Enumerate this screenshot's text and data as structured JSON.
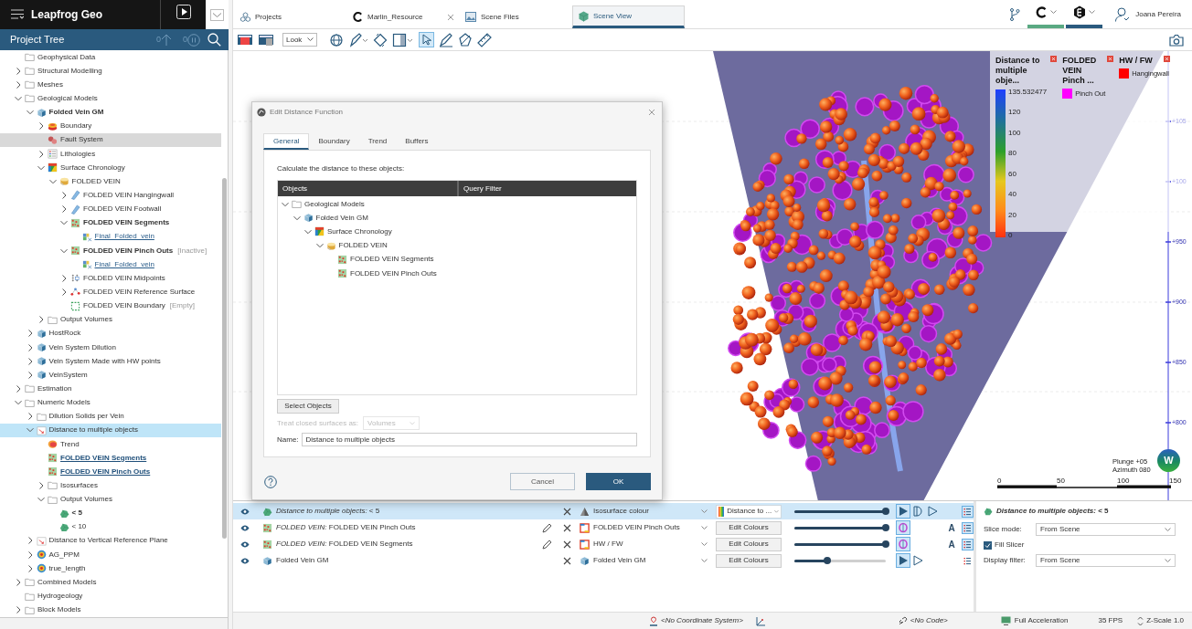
{
  "app": {
    "title": "Leapfrog Geo"
  },
  "project_tree": {
    "title": "Project Tree",
    "up_count": "0",
    "pause_count": "0",
    "items": [
      {
        "label": "Geophysical Data",
        "kind": "folder",
        "bold": false,
        "link": false,
        "selected": false,
        "hovered": false
      },
      {
        "label": "Structural Modelling",
        "kind": "folder",
        "bold": false,
        "link": false,
        "expanded": false,
        "selected": false,
        "hovered": false
      },
      {
        "label": "Meshes",
        "kind": "folder",
        "bold": false,
        "link": false,
        "expanded": false,
        "selected": false,
        "hovered": false
      },
      {
        "label": "Geological Models",
        "kind": "folder",
        "bold": false,
        "link": false,
        "expanded": true,
        "selected": false,
        "hovered": false,
        "children": [
          {
            "label": "Folded Vein GM",
            "kind": "geomodel",
            "bold": true,
            "link": false,
            "expanded": true,
            "selected": false,
            "hovered": false,
            "children": [
              {
                "label": "Boundary",
                "kind": "boundary",
                "bold": false,
                "link": false,
                "expanded": false,
                "selected": false,
                "hovered": false
              },
              {
                "label": "Fault System",
                "kind": "fault",
                "bold": false,
                "link": false,
                "selected": false,
                "hovered": true
              },
              {
                "label": "Lithologies",
                "kind": "lithology",
                "bold": false,
                "link": false,
                "expanded": false,
                "selected": false,
                "hovered": false
              },
              {
                "label": "Surface Chronology",
                "kind": "chronology",
                "bold": false,
                "link": false,
                "expanded": true,
                "selected": false,
                "hovered": false,
                "children": [
                  {
                    "label": "FOLDED VEIN",
                    "kind": "vein",
                    "bold": false,
                    "link": false,
                    "expanded": true,
                    "selected": false,
                    "hovered": false,
                    "children": [
                      {
                        "label": "FOLDED VEIN Hangingwall",
                        "kind": "surface",
                        "bold": false,
                        "link": false,
                        "expanded": false,
                        "selected": false,
                        "hovered": false
                      },
                      {
                        "label": "FOLDED VEIN Footwall",
                        "kind": "surface",
                        "bold": false,
                        "link": false,
                        "expanded": false,
                        "selected": false,
                        "hovered": false
                      },
                      {
                        "label": "FOLDED VEIN Segments",
                        "kind": "points",
                        "bold": true,
                        "link": false,
                        "expanded": true,
                        "selected": false,
                        "hovered": false,
                        "children": [
                          {
                            "label": "Final_Folded_vein",
                            "kind": "mesh",
                            "bold": false,
                            "link": true,
                            "selected": false,
                            "hovered": false
                          }
                        ]
                      },
                      {
                        "label": "FOLDED VEIN Pinch Outs",
                        "suffix": "[Inactive]",
                        "kind": "points",
                        "bold": true,
                        "link": false,
                        "expanded": true,
                        "selected": false,
                        "hovered": false,
                        "children": [
                          {
                            "label": "Final_Folded_vein",
                            "kind": "mesh",
                            "bold": false,
                            "link": true,
                            "selected": false,
                            "hovered": false
                          }
                        ]
                      },
                      {
                        "label": "FOLDED VEIN Midpoints",
                        "kind": "midpoints",
                        "bold": false,
                        "link": false,
                        "expanded": false,
                        "selected": false,
                        "hovered": false
                      },
                      {
                        "label": "FOLDED VEIN Reference Surface",
                        "kind": "refsurface",
                        "bold": false,
                        "link": false,
                        "expanded": false,
                        "selected": false,
                        "hovered": false
                      },
                      {
                        "label": "FOLDED VEIN Boundary",
                        "suffix": "[Empty]",
                        "kind": "boundarydots",
                        "bold": false,
                        "link": false,
                        "selected": false,
                        "hovered": false
                      }
                    ]
                  }
                ]
              },
              {
                "label": "Output Volumes",
                "kind": "folder",
                "bold": false,
                "link": false,
                "expanded": false,
                "selected": false,
                "hovered": false
              }
            ]
          },
          {
            "label": "HostRock",
            "kind": "geomodel",
            "bold": false,
            "link": false,
            "expanded": false,
            "selected": false,
            "hovered": false
          },
          {
            "label": "Vein System Dilution",
            "kind": "geomodel",
            "bold": false,
            "link": false,
            "expanded": false,
            "selected": false,
            "hovered": false
          },
          {
            "label": "Vein System Made with HW points",
            "kind": "geomodel",
            "bold": false,
            "link": false,
            "expanded": false,
            "selected": false,
            "hovered": false
          },
          {
            "label": "VeinSystem",
            "kind": "geomodel",
            "bold": false,
            "link": false,
            "expanded": false,
            "selected": false,
            "hovered": false
          }
        ]
      },
      {
        "label": "Estimation",
        "kind": "folder",
        "bold": false,
        "link": false,
        "expanded": false,
        "selected": false,
        "hovered": false
      },
      {
        "label": "Numeric Models",
        "kind": "folder",
        "bold": false,
        "link": false,
        "expanded": true,
        "selected": false,
        "hovered": false,
        "children": [
          {
            "label": "Dilution Solids per Vein",
            "kind": "folder",
            "bold": false,
            "link": false,
            "expanded": false,
            "selected": false,
            "hovered": false
          },
          {
            "label": "Distance to multiple objects",
            "kind": "numeric",
            "bold": false,
            "link": false,
            "expanded": true,
            "selected": true,
            "hovered": false,
            "children": [
              {
                "label": "Trend",
                "kind": "trend",
                "bold": false,
                "link": false,
                "selected": false,
                "hovered": false
              },
              {
                "label": "FOLDED VEIN Segments",
                "kind": "points",
                "bold": true,
                "link": true,
                "selected": false,
                "hovered": false
              },
              {
                "label": "FOLDED VEIN Pinch Outs",
                "kind": "points",
                "bold": true,
                "link": true,
                "selected": false,
                "hovered": false
              },
              {
                "label": "Isosurfaces",
                "kind": "folder",
                "bold": false,
                "link": false,
                "expanded": false,
                "selected": false,
                "hovered": false
              },
              {
                "label": "Output Volumes",
                "kind": "folder",
                "bold": false,
                "link": false,
                "expanded": true,
                "selected": false,
                "hovered": false,
                "children": [
                  {
                    "label": "< 5",
                    "kind": "volume",
                    "bold": true,
                    "link": false,
                    "selected": false,
                    "hovered": false
                  },
                  {
                    "label": "< 10",
                    "kind": "volume",
                    "bold": false,
                    "link": false,
                    "selected": false,
                    "hovered": false
                  }
                ]
              }
            ]
          },
          {
            "label": "Distance to Vertical Reference Plane",
            "kind": "numeric",
            "bold": false,
            "link": false,
            "expanded": false,
            "selected": false,
            "hovered": false
          },
          {
            "label": "AG_PPM",
            "kind": "interp",
            "bold": false,
            "link": false,
            "expanded": false,
            "selected": false,
            "hovered": false
          },
          {
            "label": "true_length",
            "kind": "interp",
            "bold": false,
            "link": false,
            "expanded": false,
            "selected": false,
            "hovered": false
          }
        ]
      },
      {
        "label": "Combined Models",
        "kind": "folder",
        "bold": false,
        "link": false,
        "expanded": false,
        "selected": false,
        "hovered": false
      },
      {
        "label": "Hydrogeology",
        "kind": "folder",
        "bold": false,
        "link": false,
        "selected": false,
        "hovered": false
      },
      {
        "label": "Block Models",
        "kind": "folder",
        "bold": false,
        "link": false,
        "expanded": false,
        "selected": false,
        "hovered": false
      }
    ]
  },
  "tabs": [
    {
      "label": "Projects",
      "kind": "projects",
      "closable": false,
      "selected": false
    },
    {
      "label": "Marlin_Resource",
      "kind": "logo",
      "closable": true,
      "selected": false
    },
    {
      "label": "Scene Files",
      "kind": "files",
      "closable": false,
      "selected": false
    },
    {
      "label": "Scene View",
      "kind": "scene",
      "closable": false,
      "selected": true
    }
  ],
  "user": {
    "name": "Joana Pereira"
  },
  "toolbar": {
    "view_mode": "Look"
  },
  "legends": [
    {
      "kind": "colorbar",
      "title": "Distance to multiple obje...",
      "ticks": [
        "135.532477",
        "120",
        "100",
        "80",
        "60",
        "40",
        "20",
        "0"
      ]
    },
    {
      "kind": "swatches",
      "title": "FOLDED VEIN Pinch ...",
      "items": [
        {
          "label": "Pinch Out",
          "color": "#ff00ff"
        }
      ]
    },
    {
      "kind": "swatches",
      "title": "HW / FW",
      "items": [
        {
          "label": "Hangingwall",
          "color": "#ff0000"
        }
      ]
    }
  ],
  "axis_labels": [
    "+105",
    "+100",
    "+950",
    "+900",
    "+850",
    "+800"
  ],
  "scale_labels": [
    "0",
    "50",
    "100",
    "150"
  ],
  "orientation": {
    "plunge": "Plunge +05",
    "azimuth": "Azimuth 080",
    "compass": "W"
  },
  "dialog": {
    "title": "Edit Distance Function",
    "tabs": [
      {
        "label": "General",
        "selected": true
      },
      {
        "label": "Boundary",
        "selected": false
      },
      {
        "label": "Trend",
        "selected": false
      },
      {
        "label": "Buffers",
        "selected": false
      }
    ],
    "instruction": "Calculate the distance to these objects:",
    "columns": [
      "Objects",
      "Query Filter"
    ],
    "objects": [
      {
        "label": "Geological Models",
        "kind": "folder",
        "expanded": true,
        "children": [
          {
            "label": "Folded Vein GM",
            "kind": "geomodel",
            "expanded": true,
            "children": [
              {
                "label": "Surface Chronology",
                "kind": "chronology",
                "expanded": true,
                "children": [
                  {
                    "label": "FOLDED VEIN",
                    "kind": "vein",
                    "expanded": true,
                    "children": [
                      {
                        "label": "FOLDED VEIN Segments",
                        "kind": "points"
                      },
                      {
                        "label": "FOLDED VEIN Pinch Outs",
                        "kind": "points"
                      }
                    ]
                  }
                ]
              }
            ]
          }
        ]
      }
    ],
    "select_button": "Select Objects",
    "closed_surfaces": {
      "label": "Treat closed surfaces as:",
      "value": "Volumes",
      "disabled": true
    },
    "name": {
      "label": "Name:",
      "value": "Distance to multiple objects"
    },
    "buttons": [
      {
        "label": "Cancel",
        "kind": "secondary"
      },
      {
        "label": "OK",
        "kind": "primary"
      }
    ]
  },
  "shapes": [
    {
      "selected": true,
      "visible": true,
      "kind": "volume",
      "name": "*Distance to multiple objects:* < 5",
      "editable": false,
      "colouring": {
        "kind": "isosurface",
        "label": "Isosurface colour"
      },
      "colour_control": {
        "kind": "colormap",
        "label": "Distance to ..."
      },
      "level": 1,
      "modes": [
        {
          "kind": "solid",
          "on": true
        },
        {
          "kind": "slice",
          "on": false
        },
        {
          "kind": "outline",
          "on": false
        }
      ],
      "properties_on": true
    },
    {
      "selected": false,
      "visible": true,
      "kind": "points",
      "name": "*FOLDED VEIN:* FOLDED VEIN Pinch Outs",
      "editable": true,
      "colouring": {
        "kind": "category",
        "label": "FOLDED VEIN Pinch Outs"
      },
      "colour_control": {
        "kind": "button",
        "label": "Edit Colours"
      },
      "level": 1,
      "modes": [
        {
          "kind": "points",
          "on": true
        }
      ],
      "label_toggle": "A",
      "properties_on": true
    },
    {
      "selected": false,
      "visible": true,
      "kind": "points",
      "name": "*FOLDED VEIN:* FOLDED VEIN Segments",
      "editable": true,
      "colouring": {
        "kind": "category",
        "label": "HW / FW"
      },
      "colour_control": {
        "kind": "button",
        "label": "Edit Colours"
      },
      "level": 1,
      "modes": [
        {
          "kind": "points",
          "on": true
        }
      ],
      "label_toggle": "A",
      "properties_on": true
    },
    {
      "selected": false,
      "visible": true,
      "kind": "geomodel",
      "name": "Folded Vein GM",
      "editable": false,
      "colouring": {
        "kind": "geomodel",
        "label": "Folded Vein GM"
      },
      "colour_control": {
        "kind": "button",
        "label": "Edit Colours"
      },
      "level": 0.36,
      "modes": [
        {
          "kind": "solid",
          "on": true
        },
        {
          "kind": "outline",
          "on": false
        }
      ],
      "properties_on": false
    }
  ],
  "properties": {
    "title": "*Distance to multiple objects:* < 5",
    "slice_mode": {
      "label": "Slice mode:",
      "value": "From Scene"
    },
    "fill_slicer": {
      "label": "Fill Slicer",
      "checked": true
    },
    "display_filter": {
      "label": "Display filter:",
      "value": "From Scene"
    }
  },
  "status_bar": {
    "coordinate_system": "<No Coordinate System>",
    "code": "<No Code>",
    "acceleration": "Full Acceleration",
    "fps": "35 FPS",
    "z_scale": "Z-Scale 1.0"
  }
}
